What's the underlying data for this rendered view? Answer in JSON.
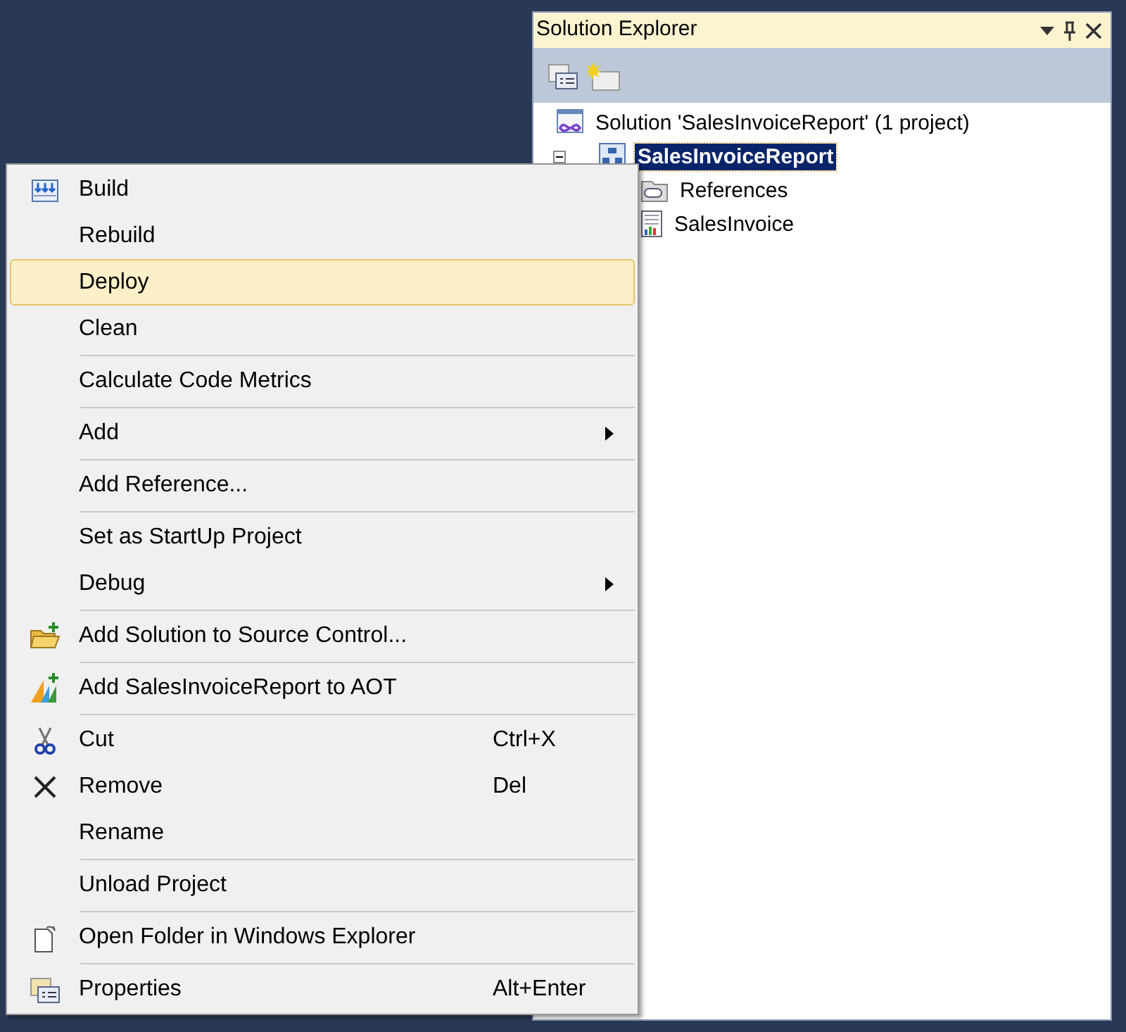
{
  "panel": {
    "title": "Solution Explorer"
  },
  "tree": [
    {
      "label": "Solution 'SalesInvoiceReport' (1 project)",
      "selected": false,
      "children": [
        {
          "label": "SalesInvoiceReport",
          "selected": true,
          "expanded": true,
          "children": [
            {
              "label": "References",
              "selected": false
            },
            {
              "label": "SalesInvoice",
              "selected": false
            }
          ]
        }
      ]
    }
  ],
  "context_menu": [
    {
      "kind": "item",
      "label": "Build",
      "selected": false
    },
    {
      "kind": "item",
      "label": "Rebuild",
      "selected": false
    },
    {
      "kind": "item",
      "label": "Deploy",
      "selected": true
    },
    {
      "kind": "item",
      "label": "Clean",
      "selected": false
    },
    {
      "kind": "separator"
    },
    {
      "kind": "item",
      "label": "Calculate Code Metrics",
      "selected": false
    },
    {
      "kind": "separator"
    },
    {
      "kind": "item",
      "label": "Add",
      "selected": false,
      "submenu": true
    },
    {
      "kind": "separator"
    },
    {
      "kind": "item",
      "label": "Add Reference...",
      "selected": false
    },
    {
      "kind": "separator"
    },
    {
      "kind": "item",
      "label": "Set as StartUp Project",
      "selected": false
    },
    {
      "kind": "item",
      "label": "Debug",
      "selected": false,
      "submenu": true
    },
    {
      "kind": "separator"
    },
    {
      "kind": "item",
      "label": "Add Solution to Source Control...",
      "selected": false
    },
    {
      "kind": "separator"
    },
    {
      "kind": "item",
      "label": "Add SalesInvoiceReport to AOT",
      "selected": false
    },
    {
      "kind": "separator"
    },
    {
      "kind": "item",
      "label": "Cut",
      "selected": false,
      "shortcut": "Ctrl+X"
    },
    {
      "kind": "item",
      "label": "Remove",
      "selected": false,
      "shortcut": "Del"
    },
    {
      "kind": "item",
      "label": "Rename",
      "selected": false
    },
    {
      "kind": "separator"
    },
    {
      "kind": "item",
      "label": "Unload Project",
      "selected": false
    },
    {
      "kind": "separator"
    },
    {
      "kind": "item",
      "label": "Open Folder in Windows Explorer",
      "selected": false
    },
    {
      "kind": "separator"
    },
    {
      "kind": "item",
      "label": "Properties",
      "selected": false,
      "shortcut": "Alt+Enter"
    }
  ]
}
